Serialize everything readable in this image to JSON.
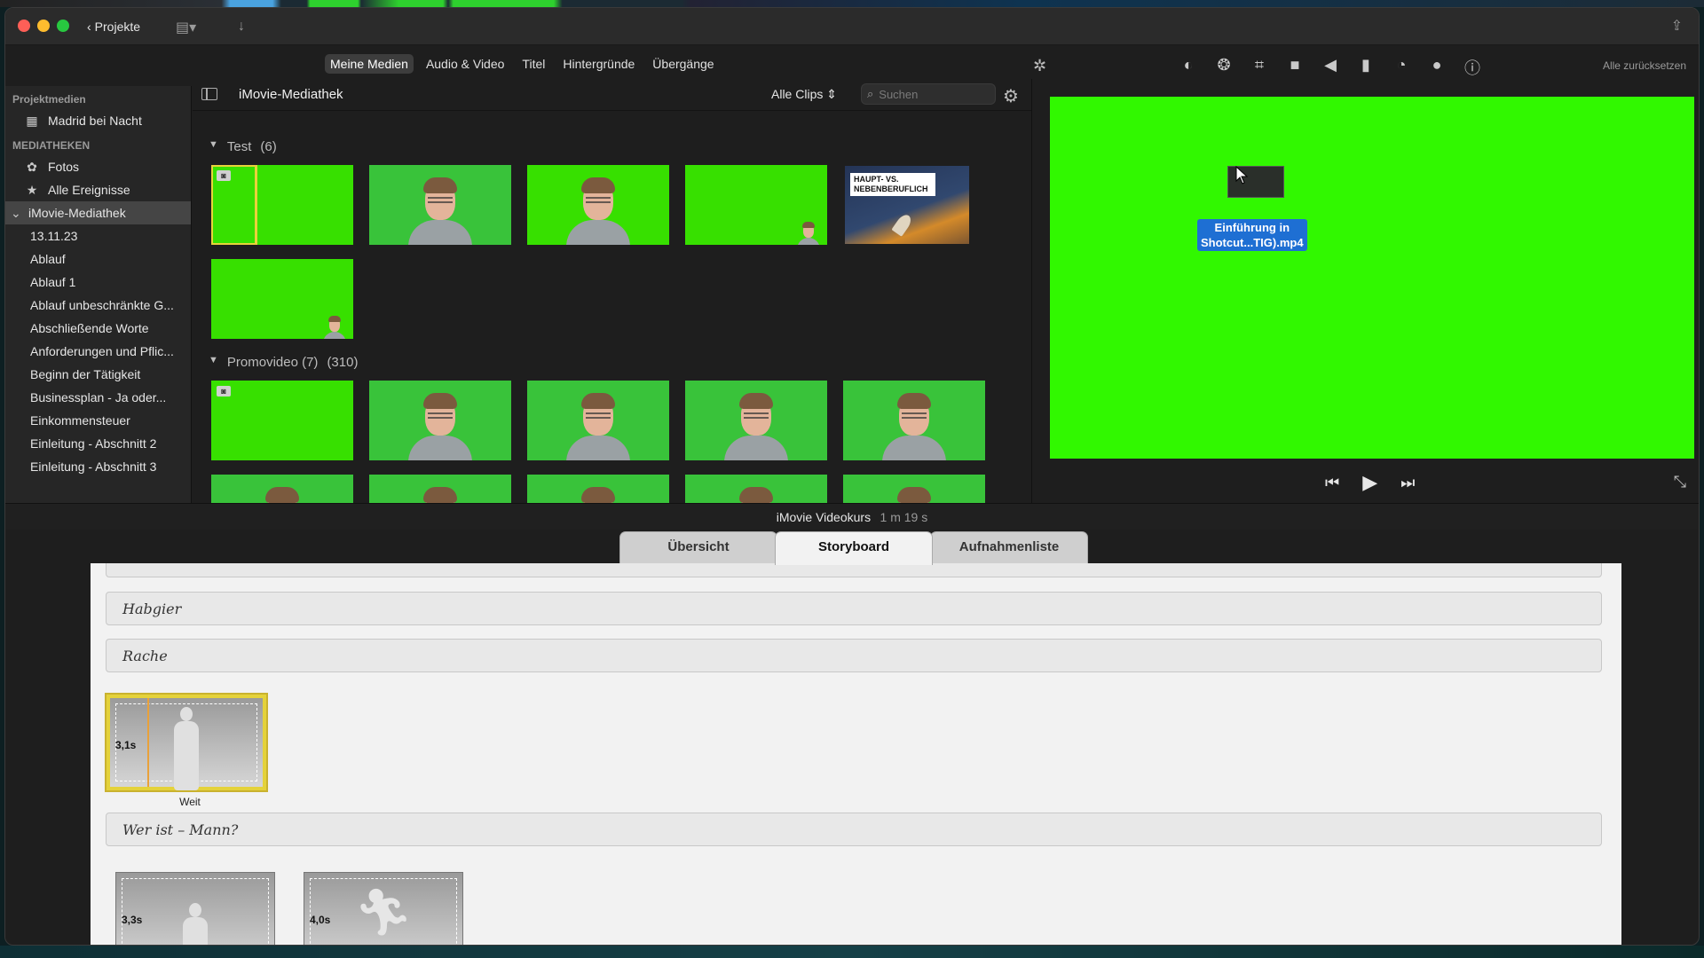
{
  "titlebar": {
    "back_label": "Projekte"
  },
  "media_tabs": [
    "Meine Medien",
    "Audio & Video",
    "Titel",
    "Hintergründe",
    "Übergänge"
  ],
  "viewer_toolbar": {
    "reset_label": "Alle zurücksetzen",
    "icons": [
      "color-balance-icon",
      "color-correction-icon",
      "crop-icon",
      "stabilization-icon",
      "volume-icon",
      "equalizer-icon",
      "speed-icon",
      "noise-reduction-icon",
      "info-icon"
    ]
  },
  "sidebar": {
    "project_media_header": "Projektmedien",
    "project_item": "Madrid bei Nacht",
    "libraries_header": "MEDIATHEKEN",
    "photos": "Fotos",
    "all_events": "Alle Ereignisse",
    "library": "iMovie-Mediathek",
    "events": [
      "13.11.23",
      "Ablauf",
      "Ablauf 1",
      "Ablauf unbeschränkte G...",
      "Abschließende Worte",
      "Anforderungen und Pflic...",
      "Beginn der Tätigkeit",
      "Businessplan - Ja oder...",
      "Einkommensteuer",
      "Einleitung - Abschnitt 2",
      "Einleitung - Abschnitt 3"
    ]
  },
  "browser": {
    "title": "iMovie-Mediathek",
    "filter": "Alle Clips",
    "search_placeholder": "Suchen",
    "event1": {
      "name": "Test",
      "count": "(6)"
    },
    "event2": {
      "name": "Promovideo (7)",
      "count": "(310)"
    },
    "doc_thumb_text": "HAUPT- VS. NEBENBERUFLICH"
  },
  "viewer": {
    "drag_label_line1": "Einführung in",
    "drag_label_line2": "Shotcut...TIG).mp4"
  },
  "project": {
    "title": "iMovie Videokurs",
    "duration": "1 m 19 s"
  },
  "trailer_tabs": [
    "Übersicht",
    "Storyboard",
    "Aufnahmenliste"
  ],
  "storyboard": {
    "rows": [
      "Habgier",
      "Rache",
      "Wer ist – Mann?"
    ],
    "shots": [
      {
        "duration": "3,1s",
        "caption": "Weit"
      },
      {
        "duration": "3,3s",
        "caption": ""
      },
      {
        "duration": "4,0s",
        "caption": ""
      }
    ]
  }
}
